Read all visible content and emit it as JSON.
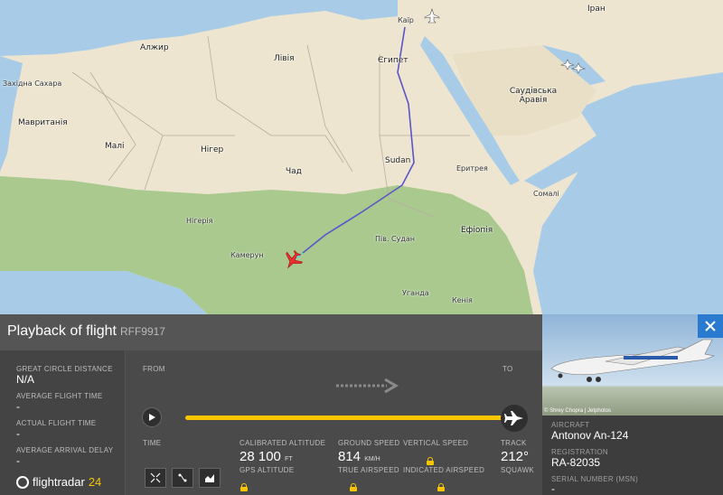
{
  "map": {
    "labels": {
      "iran": "Іран",
      "algeria": "Алжир",
      "libya": "Лівія",
      "egypt": "Єгипет",
      "saudi": "Саудівська Аравія",
      "mauritania": "Мавританія",
      "mali": "Малі",
      "niger": "Нігер",
      "chad": "Чад",
      "sudan": "Sudan",
      "ethiopia": "Ефіопія",
      "eritrea": "Еритрея",
      "cameroon": "Камерун",
      "south_sudan": "Пів. Судан",
      "kenya": "Кенія",
      "uganda": "Уганда",
      "somalia": "Сомалі",
      "western_sahara": "Західна Сахара",
      "nigeria": "Нігерія",
      "cairo": "Каїр"
    }
  },
  "panel": {
    "title": "Playback of flight",
    "callsign": "RFF9917",
    "stats": [
      {
        "label": "GREAT CIRCLE DISTANCE",
        "value": "N/A"
      },
      {
        "label": "AVERAGE FLIGHT TIME",
        "value": "-"
      },
      {
        "label": "ACTUAL FLIGHT TIME",
        "value": "-"
      },
      {
        "label": "AVERAGE ARRIVAL DELAY",
        "value": "-"
      }
    ],
    "from_label": "FROM",
    "to_label": "TO",
    "time_label": "TIME",
    "cal_alt_label": "CALIBRATED ALTITUDE",
    "cal_alt_value": "28 100",
    "cal_alt_unit": "FT",
    "gps_alt_label": "GPS ALTITUDE",
    "ground_speed_label": "GROUND SPEED",
    "ground_speed_value": "814",
    "ground_speed_unit": "KM/H",
    "true_airspeed_label": "TRUE AIRSPEED",
    "vertical_speed_label": "VERTICAL SPEED",
    "indicated_airspeed_label": "INDICATED AIRSPEED",
    "track_label": "TRACK",
    "track_value": "212°",
    "squawk_label": "SQUAWK",
    "playback_progress": 1.0
  },
  "logo": {
    "text": "flightradar",
    "suffix": "24"
  },
  "aircraft": {
    "photo_credit": "© Shrey Chopra | Jetphotos",
    "aircraft_label": "AIRCRAFT",
    "aircraft_value": "Antonov An-124",
    "registration_label": "REGISTRATION",
    "registration_value": "RA-82035",
    "serial_label": "SERIAL NUMBER (MSN)",
    "serial_value": "-"
  },
  "colors": {
    "accent": "#f7c600",
    "route": "#5a55c9",
    "close": "#2a7ad0"
  }
}
